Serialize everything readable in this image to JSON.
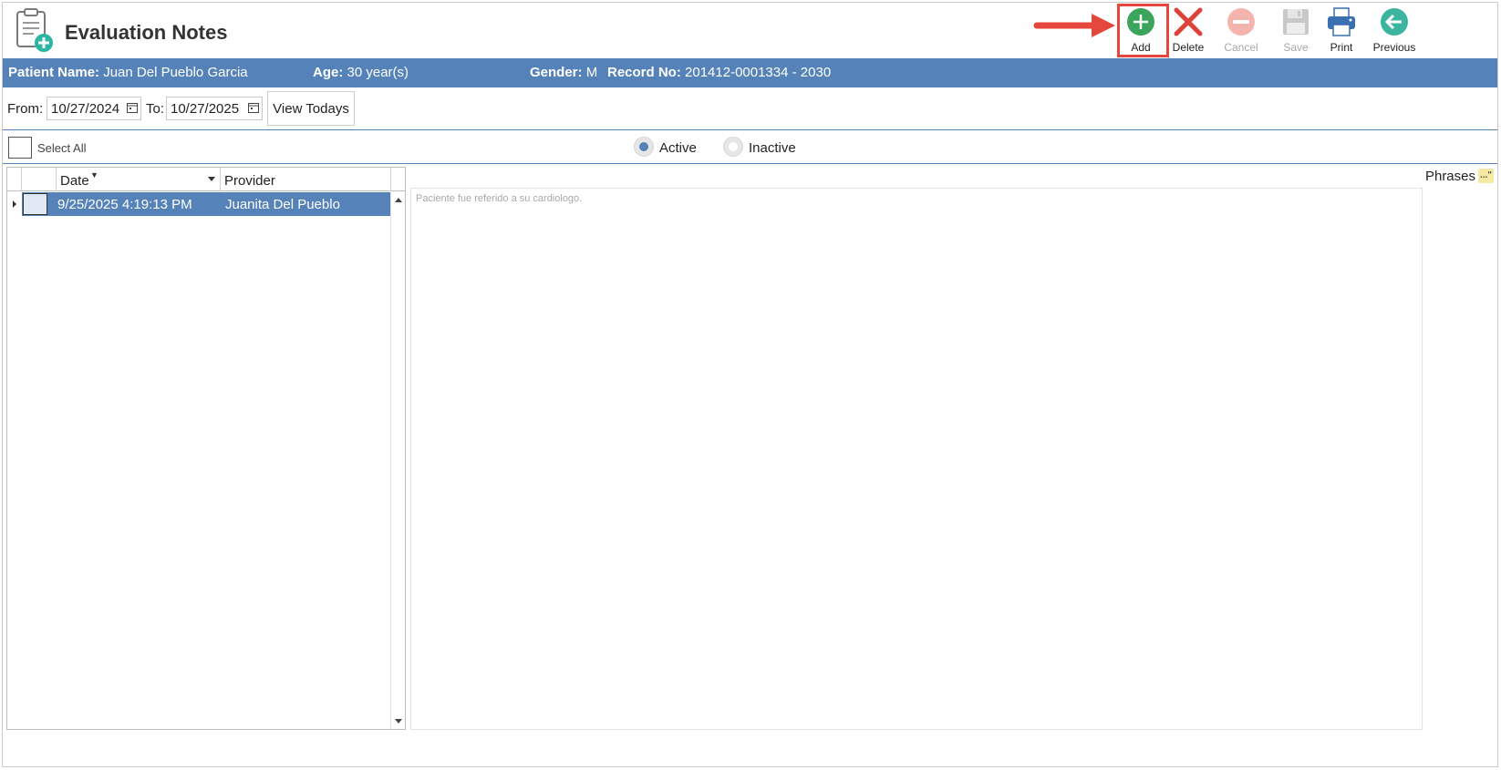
{
  "header": {
    "title": "Evaluation Notes"
  },
  "toolbar": {
    "add_label": "Add",
    "delete_label": "Delete",
    "cancel_label": "Cancel",
    "save_label": "Save",
    "print_label": "Print",
    "previous_label": "Previous"
  },
  "patient": {
    "name_label": "Patient Name:",
    "name_value": "Juan Del Pueblo Garcia",
    "age_label": "Age:",
    "age_value": "30 year(s)",
    "gender_label": "Gender:",
    "gender_value": "M",
    "record_label": "Record No:",
    "record_value": "201412-0001334 - 2030"
  },
  "filter": {
    "from_label": "From:",
    "from_value": "10/27/2024",
    "to_label": "To:",
    "to_value": "10/27/2025",
    "view_todays_label": "View Todays"
  },
  "selection": {
    "select_all_label": "Select All",
    "active_label": "Active",
    "inactive_label": "Inactive",
    "active_selected": true
  },
  "grid": {
    "columns": [
      "Date",
      "Provider"
    ],
    "rows": [
      {
        "date": "9/25/2025 4:19:13 PM",
        "provider": "Juanita Del Pueblo"
      }
    ]
  },
  "notes": {
    "phrases_label": "Phrases",
    "phrases_icon_text": "...\"",
    "note_text": "Paciente fue referido a su cardiologo."
  },
  "colors": {
    "accent": "#5582b8",
    "add_green": "#3aa55b",
    "delete_red": "#e0403a",
    "highlight_red": "#e5473d",
    "previous_teal": "#3bb59f"
  }
}
